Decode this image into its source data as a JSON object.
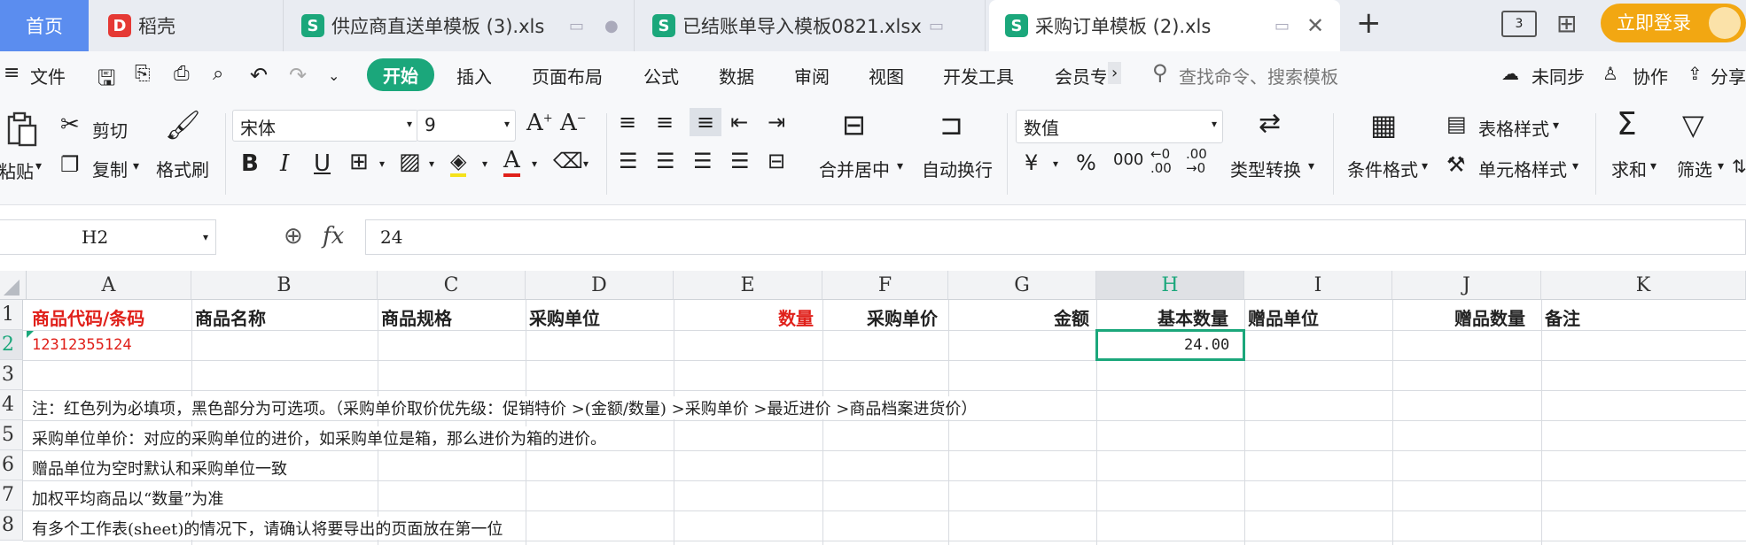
{
  "tabs": {
    "home": "首页",
    "daoke": "稻壳",
    "file1": "供应商直送单模板 (3).xls",
    "file2": "已结账单导入模板0821.xlsx",
    "file3": "采购订单模板 (2).xls",
    "add": "+",
    "login": "立即登录"
  },
  "menu": {
    "file": "文件",
    "items": [
      "开始",
      "插入",
      "页面布局",
      "公式",
      "数据",
      "审阅",
      "视图",
      "开发工具",
      "会员专"
    ],
    "search_placeholder": "查找命令、搜索模板",
    "sync": "未同步",
    "collab": "协作",
    "share": "分享"
  },
  "ribbon": {
    "paste": "粘贴",
    "cut": "剪切",
    "copy": "复制",
    "format_painter": "格式刷",
    "font_name": "宋体",
    "font_size": "9",
    "merge_center": "合并居中",
    "wrap_text": "自动换行",
    "number_format": "数值",
    "convert_type": "类型转换",
    "conditional_format": "条件格式",
    "table_style": "表格样式",
    "cell_style": "单元格样式",
    "sum": "求和",
    "filter": "筛选"
  },
  "formula_bar": {
    "cell_ref": "H2",
    "fx": "fx",
    "value": "24"
  },
  "sheet": {
    "columns": [
      "A",
      "B",
      "C",
      "D",
      "E",
      "F",
      "G",
      "H",
      "I",
      "J",
      "K"
    ],
    "rows": [
      "1",
      "2",
      "3",
      "4",
      "5",
      "6",
      "7",
      "8"
    ],
    "headers": {
      "a": "商品代码/条码",
      "b": "商品名称",
      "c": "商品规格",
      "d": "采购单位",
      "e": "数量",
      "f": "采购单价",
      "g": "金额",
      "h": "基本数量",
      "i": "赠品单位",
      "j": "赠品数量",
      "k": "备注"
    },
    "row2": {
      "a": "12312355124",
      "h": "24.00"
    },
    "notes": [
      "注：红色列为必填项，黑色部分为可选项。（采购单价取价优先级：促销特价 >(金额/数量) >采购单价 >最近进价 >商品档案进货价）",
      "采购单位单价：对应的采购单位的进价，如采购单位是箱，那么进价为箱的进价。",
      "赠品单位为空时默认和采购单位一致",
      "加权平均商品以“数量”为准",
      "有多个工作表(sheet)的情况下，请确认将要导出的页面放在第一位"
    ]
  },
  "colors": {
    "required": "#e0201a",
    "accent_green": "#1ba77b",
    "login_orange": "#f2a712"
  }
}
